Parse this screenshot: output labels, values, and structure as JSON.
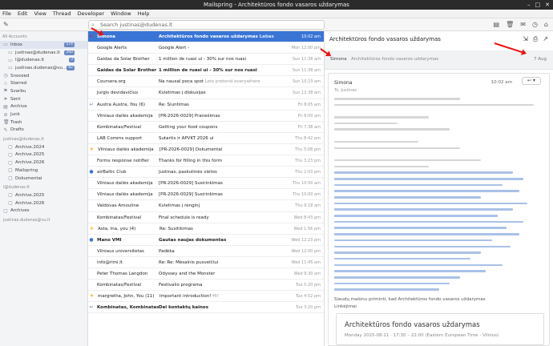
{
  "window": {
    "title": "Mailspring - Architektūros fondo vasaros uždarymas"
  },
  "menu": [
    "File",
    "Edit",
    "View",
    "Thread",
    "Developer",
    "Window",
    "Help"
  ],
  "search": {
    "placeholder": "Search justinas@dudenas.lt"
  },
  "sidebar": {
    "section_label": "All Accounts",
    "items": [
      {
        "label": "Inbox",
        "badge": "574",
        "icon": "inbox-icon",
        "selected": true
      },
      {
        "label": "justinas@dudenas.lt",
        "badge": "260",
        "sub": true,
        "icon": "inbox-icon"
      },
      {
        "label": "l@dudenas.lt",
        "badge": "3",
        "sub": true,
        "icon": "inbox-icon"
      },
      {
        "label": "justinas.dudenas@vu...",
        "badge": "82",
        "sub": true,
        "icon": "inbox-icon"
      },
      {
        "label": "Snoozed",
        "icon": "clock-icon"
      },
      {
        "label": "Starred",
        "icon": "star-icon"
      },
      {
        "label": "Svarbu",
        "icon": "flag-icon"
      },
      {
        "label": "Sent",
        "icon": "send-icon"
      },
      {
        "label": "Archive",
        "icon": "archive-icon"
      },
      {
        "label": "Junk",
        "icon": "junk-icon"
      },
      {
        "label": "Trash",
        "icon": "trash-icon"
      },
      {
        "label": "Drafts",
        "icon": "draft-icon"
      },
      {
        "label": "justinas@dudenas.lt",
        "header": true
      },
      {
        "label": "Archive.2024",
        "sub": true,
        "icon": "folder-icon"
      },
      {
        "label": "Archive.2025",
        "sub": true,
        "icon": "folder-icon"
      },
      {
        "label": "Archive.2026",
        "sub": true,
        "icon": "folder-icon"
      },
      {
        "label": "Mailspring",
        "sub": true,
        "icon": "folder-icon"
      },
      {
        "label": "Dokumentai",
        "sub": true,
        "icon": "folder-icon"
      },
      {
        "label": "l@dudenas.lt",
        "header": true
      },
      {
        "label": "Archive.2025",
        "sub": true,
        "icon": "folder-icon"
      },
      {
        "label": "Archive.2026",
        "sub": true,
        "icon": "folder-icon"
      },
      {
        "label": "Archives",
        "icon": "folder-icon"
      },
      {
        "label": "justinas.dudenas@vu.lt",
        "header": true
      }
    ]
  },
  "threads": [
    {
      "from": "Simona",
      "subject": "Architektūros fondo vasaros uždarymas",
      "snippet": "Labas",
      "date": "10:02 am",
      "selected": true,
      "unread": true,
      "mark": "arrow"
    },
    {
      "from": "Google Alerts",
      "subject": "Google Alert - ",
      "snippet": "",
      "date": "Mon 12:00 pm",
      "mark": ""
    },
    {
      "from": "Gaidas da Solar Brother",
      "subject": "1 million de ruasi ui - 30% sur nos ruasi",
      "snippet": "",
      "date": "Sun 11:38 am",
      "mark": ""
    },
    {
      "from": "Gaidas da Solar Brother",
      "subject": "1 million de ruasi ui - 30% sur nos ruasi",
      "snippet": "",
      "date": "Sun 11:38 am",
      "mark": "",
      "unread": true
    },
    {
      "from": "Coursera.org",
      "subject": "Na nausal poca spot",
      "snippet": "Lets pretend everywhere",
      "date": "Sun 10:23 am",
      "mark": ""
    },
    {
      "from": "Jurgis devidavičius",
      "subject": "Kvietimas į diskusijas",
      "snippet": "",
      "date": "Sun 12:38 am",
      "mark": ""
    },
    {
      "from": "Austra Austra, You (6)",
      "subject": "Re: Siuntimas",
      "snippet": "",
      "date": "Fri 8:05 am",
      "mark": "arrow"
    },
    {
      "from": "Vilniaus dailės akademija",
      "subject": "[PR-2026-0029] Pranešimas",
      "snippet": "",
      "date": "Fri 8:00 am",
      "mark": ""
    },
    {
      "from": "Kombinatas/Festival",
      "subject": "Getting your food coupons",
      "snippet": "",
      "date": "Fri 7:38 am",
      "mark": ""
    },
    {
      "from": "LAB Comms support",
      "subject": "Sutartis ir APVKT 2026 ui",
      "snippet": "",
      "date": "Thu 8:42 pm",
      "mark": ""
    },
    {
      "from": "Vilniaus dailės akademija",
      "subject": "[PR-2026-0029] Dokumentai",
      "snippet": "",
      "date": "Thu 5:08 pm",
      "mark": "star"
    },
    {
      "from": "Forms response notifier",
      "subject": "Thanks for filling in this form",
      "snippet": "",
      "date": "Thu 3:23 pm",
      "mark": ""
    },
    {
      "from": "airBaltic Club",
      "subject": "Justinas, paskutinės vietos",
      "snippet": "",
      "date": "Thu 2:03 pm",
      "mark": "dot"
    },
    {
      "from": "Vilniaus dailės akademija",
      "subject": "[PR-2026-0029] Susirinkimas",
      "snippet": "",
      "date": "Thu 10:50 am",
      "mark": ""
    },
    {
      "from": "Vilniaus dailės akademija",
      "subject": "[PR-2026-0029] Susirinkimas",
      "snippet": "",
      "date": "Thu 10:00 am",
      "mark": ""
    },
    {
      "from": "Valdovas Amouline",
      "subject": "Kvietimas į renginį",
      "snippet": "",
      "date": "Thu 9:18 am",
      "mark": ""
    },
    {
      "from": "Kombinatas/Festival",
      "subject": "Final schedule is ready",
      "snippet": "",
      "date": "Wed 8:43 pm",
      "mark": ""
    },
    {
      "from": "Asta, Ina, you (4)",
      "subject": "Re: Susitikimas",
      "snippet": "",
      "date": "Wed 1:56 pm",
      "mark": "star"
    },
    {
      "from": "Mano VMI",
      "subject": "Gautas naujas dokumentas",
      "snippet": "",
      "date": "Wed 12:23 pm",
      "mark": "dot",
      "unread": true
    },
    {
      "from": "Vilniaus universitetas",
      "subject": "Padėka",
      "snippet": "",
      "date": "Wed 12:00 pm",
      "mark": ""
    },
    {
      "from": "info@rimi.lt",
      "subject": "Re: Re: Mėsainis pusvelčiui",
      "snippet": "",
      "date": "Wed 11:45 am",
      "mark": ""
    },
    {
      "from": "Peter Thomas Langdon",
      "subject": "Odyssey and the Monster",
      "snippet": "",
      "date": "Wed 9:30 am",
      "mark": ""
    },
    {
      "from": "Kombinatas/Festival",
      "subject": "Festivalio programa",
      "snippet": "",
      "date": "Tue 5:20 pm",
      "mark": ""
    },
    {
      "from": "margretha, John, You (11)",
      "subject": "Important introduction!",
      "snippet": "Hi!",
      "date": "Tue 4:52 pm",
      "mark": "star"
    },
    {
      "from": "Kombinatas, Kombinatas, You",
      "subject": "Del kontaktų kainos",
      "snippet": "",
      "date": "Tue 3:20 pm",
      "mark": "arrow",
      "unread": true
    }
  ],
  "reader": {
    "subject": "Architektūros fondo vasaros uždarymas",
    "participant": "Simona",
    "summary": "Architektūros fondo vasaros uždarymas",
    "date": "7 Aug",
    "message": {
      "sender": "Simona",
      "time": "10:02 am",
      "recipients": "To: Justinas"
    },
    "closing": "Šiaudų malonu priminti, kad Architektūros fondo vasaros uždarymas",
    "closing2": "Linkėjimai",
    "calendar": {
      "title": "Architektūros fondo vasaros uždarymas",
      "detail": "Monday 2025-08-11 · 17:30 – 22:00 (Eastern European Time - Vilnius)"
    }
  },
  "colors": {
    "accent": "#3a75d6",
    "annotation": "#e11111"
  }
}
